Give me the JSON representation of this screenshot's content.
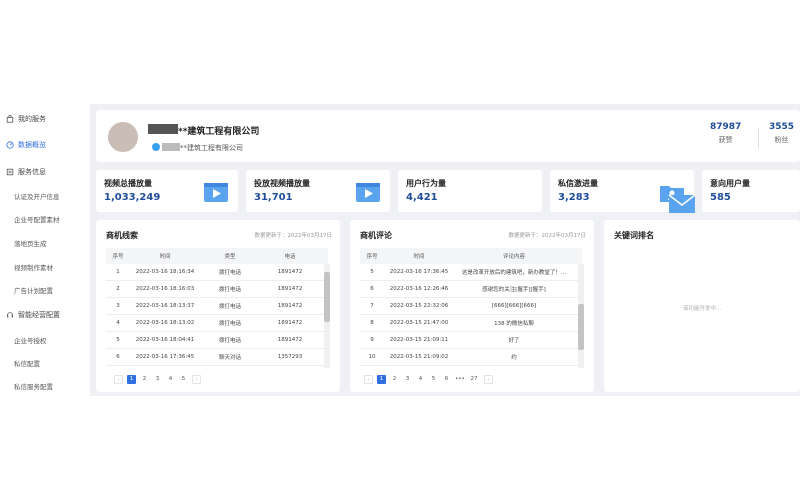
{
  "sidebar": {
    "items": [
      {
        "label": "我的服务",
        "icon": "bag-icon"
      },
      {
        "label": "数据概览",
        "icon": "dashboard-icon"
      },
      {
        "label": "服务信息",
        "icon": "list-icon"
      }
    ],
    "service_sub": [
      "认证及开户信息",
      "企业号配置素材",
      "落地页生成",
      "视频制作素材",
      "广告计划配置"
    ],
    "marketing": {
      "label": "智能经营配置",
      "icon": "headset-icon"
    },
    "marketing_sub": [
      "企业号授权",
      "私信配置",
      "私信服务配置"
    ]
  },
  "company": {
    "name": "**建筑工程有限公司",
    "sub": "**建筑工程有限公司",
    "stats": [
      {
        "value": "87987",
        "label": "获赞"
      },
      {
        "value": "3555",
        "label": "粉丝"
      }
    ]
  },
  "metrics": [
    {
      "label": "视频总播放量",
      "value": "1,033,249",
      "icon": "video-icon"
    },
    {
      "label": "投放视频播放量",
      "value": "31,701",
      "icon": "video-icon"
    },
    {
      "label": "用户行为量",
      "value": "4,421",
      "icon": ""
    },
    {
      "label": "私信激进量",
      "value": "3,283",
      "icon": "folder-user-icon"
    },
    {
      "label": "意向用户量",
      "value": "585",
      "icon": "mail-icon"
    }
  ],
  "leads": {
    "title": "商机线索",
    "updated": "数据更新于：2022年03月17日",
    "columns": [
      "序号",
      "时间",
      "类型",
      "电话"
    ],
    "rows": [
      [
        "1",
        "2022-03-16 18:16:34",
        "拨打电话",
        "1891472"
      ],
      [
        "2",
        "2022-03-16 18:16:03",
        "拨打电话",
        "1891472"
      ],
      [
        "3",
        "2022-03-16 18:13:37",
        "拨打电话",
        "1891472"
      ],
      [
        "4",
        "2022-03-16 18:13:02",
        "拨打电话",
        "1891472"
      ],
      [
        "5",
        "2022-03-16 18:04:41",
        "拨打电话",
        "1891472"
      ],
      [
        "6",
        "2022-03-16 17:36:45",
        "聊天对话",
        "1357293"
      ]
    ],
    "pages": [
      "1",
      "2",
      "3",
      "4",
      "5"
    ],
    "active_page": "1",
    "prev": "‹",
    "next": "›"
  },
  "comments": {
    "title": "商机评论",
    "updated": "数据更新于：2022年03月17日",
    "columns": [
      "序号",
      "时间",
      "评论内容"
    ],
    "rows": [
      [
        "5",
        "2022-03-16 17:36:45",
        "这是改革开放后的建筑吧，新办教堂了！..."
      ],
      [
        "6",
        "2022-03-16 12:26:46",
        "感谢您的关注[握手][握手]"
      ],
      [
        "7",
        "2022-03-15 22:32:06",
        "[666][666][666]"
      ],
      [
        "8",
        "2022-03-15 21:47:00",
        "138 的微信私聊"
      ],
      [
        "9",
        "2022-03-15 21:09:11",
        "好了"
      ],
      [
        "10",
        "2022-03-15 21:09:02",
        "约"
      ]
    ],
    "pages": [
      "1",
      "2",
      "3",
      "4",
      "5",
      "6",
      "•••",
      "27"
    ],
    "active_page": "1",
    "prev": "‹",
    "next": "›"
  },
  "keywords": {
    "title": "关键词排名",
    "empty": "该功能开发中..."
  },
  "colors": {
    "accent": "#2f6fe0",
    "number": "#1f4d99",
    "background": "#eef0f4"
  }
}
